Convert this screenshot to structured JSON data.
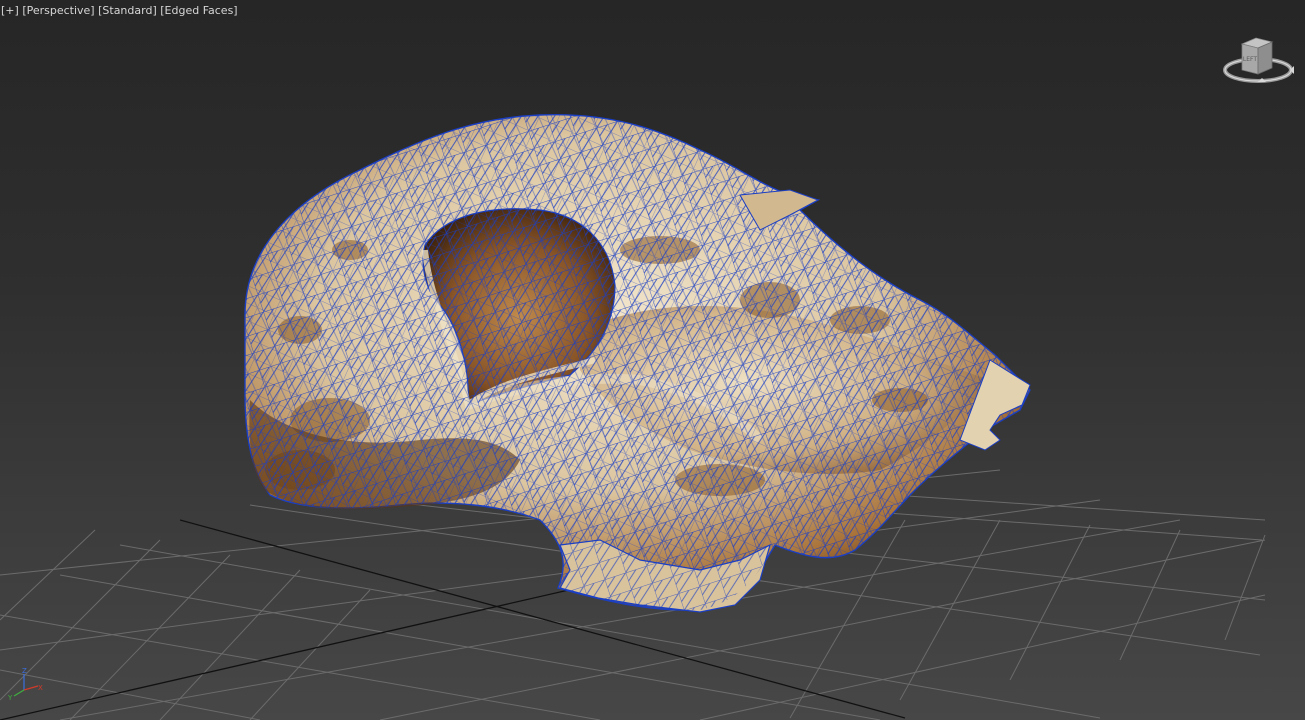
{
  "viewport": {
    "label_plus": "[+]",
    "label_view": "[Perspective]",
    "label_shading": "[Standard]",
    "label_edges": "[Edged Faces]"
  },
  "viewcube": {
    "face_label": "LEFT"
  },
  "axis_tripod": {
    "x": "X",
    "y": "Y",
    "z": "Z"
  },
  "colors": {
    "background_top": "#262626",
    "background_bottom": "#474747",
    "grid": "#6b6b6b",
    "grid_axis": "#111111",
    "wireframe": "#1b3fc4",
    "bone": "#e7d8bb",
    "bone_stain": "#8a5a25",
    "axis_x": "#d23a2a",
    "axis_y": "#3fae3f",
    "axis_z": "#3b6fe0"
  },
  "icons": {
    "viewcube": "viewcube-icon",
    "axis_tripod": "axis-tripod-icon"
  }
}
